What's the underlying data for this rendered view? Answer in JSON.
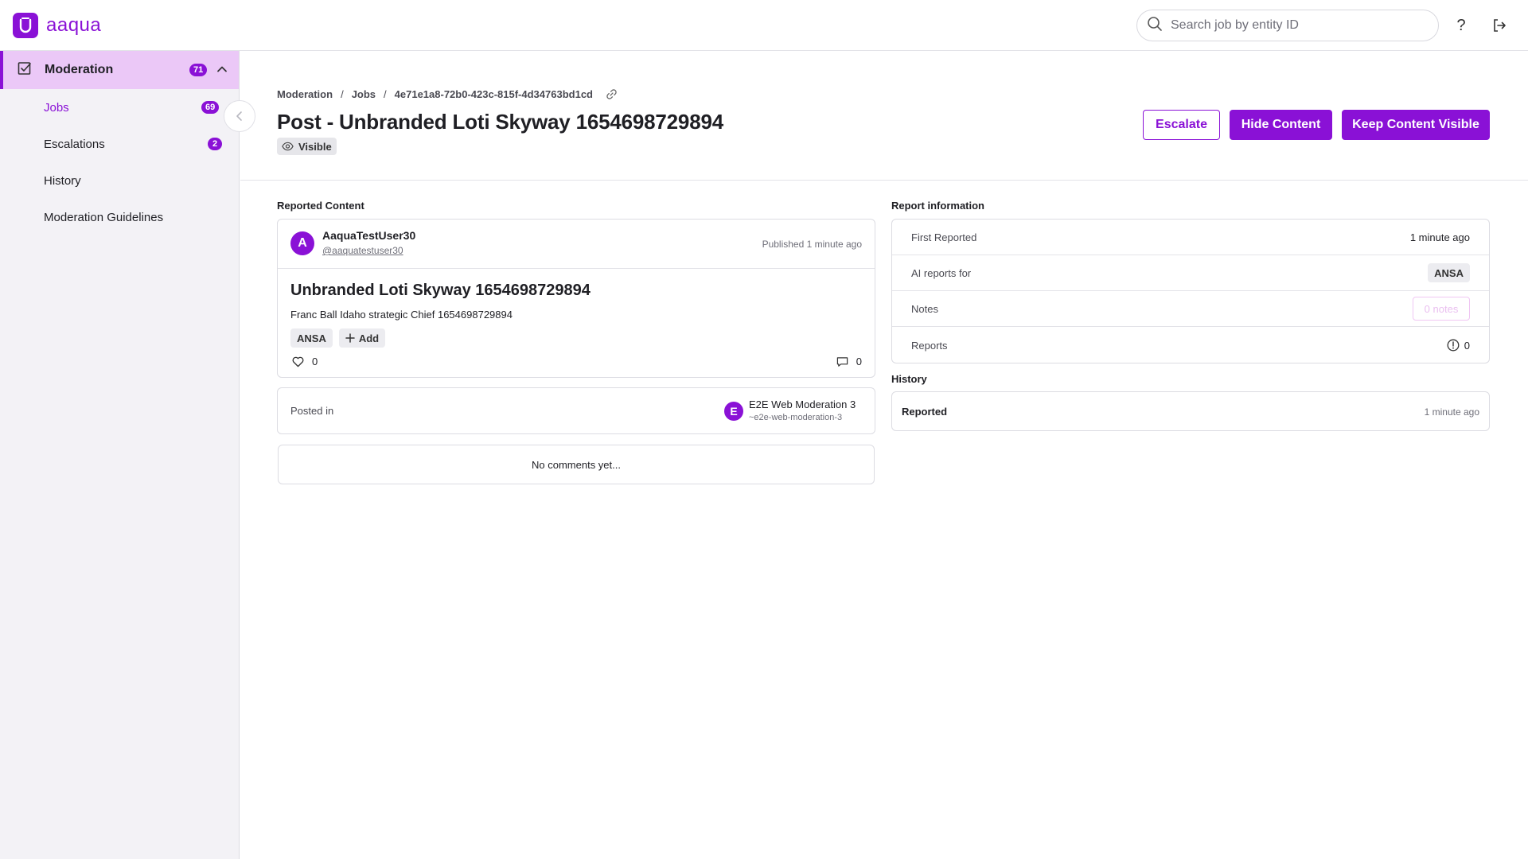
{
  "app": {
    "logo_text": "aaqua",
    "brand_color": "#8a11d6"
  },
  "search": {
    "placeholder": "Search job by entity ID"
  },
  "topbar": {
    "help_icon": "help-icon",
    "logout_icon": "logout-icon"
  },
  "sidebar": {
    "section": {
      "label": "Moderation",
      "count": "71"
    },
    "items": [
      {
        "label": "Jobs",
        "count": "69",
        "active": true
      },
      {
        "label": "Escalations",
        "count": "2"
      },
      {
        "label": "History"
      },
      {
        "label": "Moderation Guidelines"
      }
    ]
  },
  "breadcrumb": {
    "root": "Moderation",
    "jobs": "Jobs",
    "id": "4e71e1a8-72b0-423c-815f-4d34763bd1cd"
  },
  "header": {
    "title": "Post - Unbranded Loti Skyway 1654698729894",
    "status": "Visible",
    "escalate": "Escalate",
    "hide": "Hide Content",
    "keep": "Keep Content Visible"
  },
  "reported": {
    "section_label": "Reported Content",
    "author": {
      "initial": "A",
      "name": "AaquaTestUser30",
      "handle": "@aaquatestuser30"
    },
    "published": "Published 1 minute ago",
    "post_title": "Unbranded Loti Skyway 1654698729894",
    "post_body": "Franc Ball Idaho strategic Chief 1654698729894",
    "tags": [
      "ANSA"
    ],
    "add_label": "Add",
    "likes": "0",
    "comments": "0",
    "posted_in_label": "Posted in",
    "community": {
      "initial": "E",
      "name": "E2E Web Moderation 3",
      "handle": "~e2e-web-moderation-3"
    },
    "no_comments": "No comments yet..."
  },
  "report_info": {
    "section_label": "Report information",
    "rows": {
      "first_reported": {
        "label": "First Reported",
        "value": "1 minute ago"
      },
      "ai_reports": {
        "label": "AI reports for",
        "value": "ANSA"
      },
      "notes": {
        "label": "Notes",
        "value": "0 notes"
      },
      "reports": {
        "label": "Reports",
        "value": "0"
      }
    }
  },
  "history": {
    "section_label": "History",
    "entry": {
      "label": "Reported",
      "time": "1 minute ago"
    }
  }
}
